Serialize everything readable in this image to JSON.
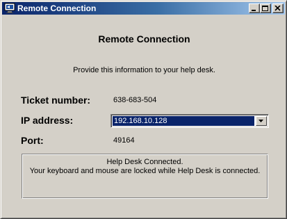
{
  "window": {
    "title": "Remote Connection",
    "title_icon": "remote-connection-icon"
  },
  "titlebar_buttons": {
    "minimize_icon": "minimize-icon",
    "maximize_icon": "maximize-icon",
    "close_icon": "close-icon"
  },
  "content": {
    "heading": "Remote Connection",
    "instruction": "Provide this information to your help desk.",
    "ticket": {
      "label": "Ticket number:",
      "value": "638-683-504"
    },
    "ip": {
      "label": "IP address:",
      "value": "192.168.10.128",
      "dropdown_icon": "chevron-down-icon"
    },
    "port": {
      "label": "Port:",
      "value": "49164"
    },
    "status": {
      "line1": "Help Desk Connected.",
      "line2": "Your keyboard and mouse are locked while Help Desk is connected."
    }
  },
  "colors": {
    "titlebar_start": "#0a246a",
    "titlebar_end": "#a6caf0",
    "window_bg": "#d4d0c8",
    "selection": "#0a246a"
  }
}
